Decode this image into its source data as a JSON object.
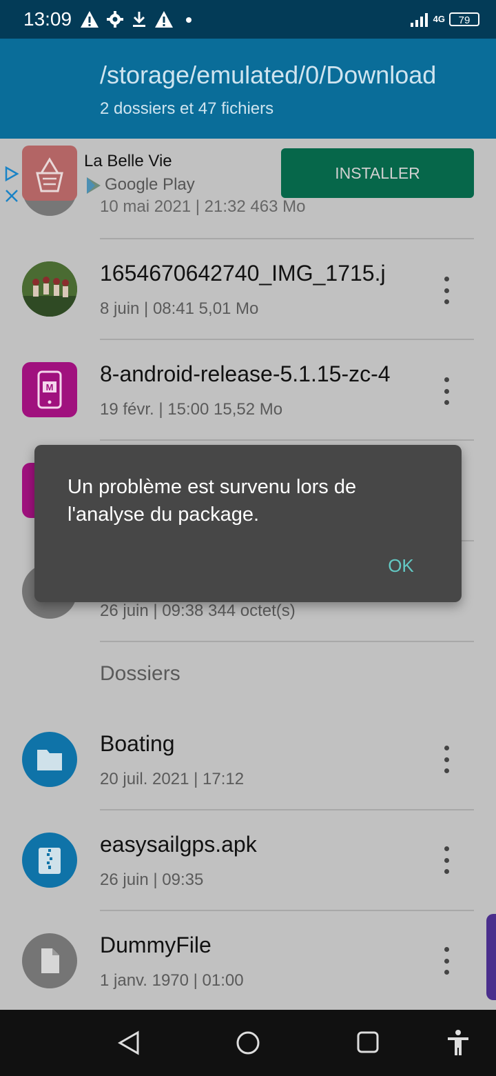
{
  "status_bar": {
    "time": "13:09",
    "network": "4G",
    "battery": "79"
  },
  "header": {
    "path": "/storage/emulated/0/Download",
    "summary": "2 dossiers et 47 fichiers"
  },
  "ad": {
    "app_name": "La Belle Vie",
    "store": "Google Play",
    "install_label": "INSTALLER"
  },
  "partial_item_meta": "10 mai 2021 | 21:32   463 Mo",
  "files": [
    {
      "name": "1654670642740_IMG_1715.j",
      "meta": "8 juin | 08:41    5,01 Mo",
      "icon": "photo-thumbnail"
    },
    {
      "name": "8-android-release-5.1.15-zc-4",
      "meta": "19 févr. | 15:00    15,52 Mo",
      "icon": "app-icon"
    }
  ],
  "hidden_item_meta": "26 juin | 09:38    344 octet(s)",
  "section_label": "Dossiers",
  "folders": [
    {
      "name": "Boating",
      "meta": "20 juil. 2021 | 17:12",
      "icon": "folder-icon"
    },
    {
      "name": "easysailgps.apk",
      "meta": "26 juin | 09:35",
      "icon": "zip-icon"
    },
    {
      "name": "DummyFile",
      "meta": "1 janv. 1970 | 01:00",
      "icon": "file-icon"
    }
  ],
  "dialog": {
    "message": "Un problème est survenu lors de l'analyse du package.",
    "ok_label": "OK"
  },
  "colors": {
    "status_bar": "#033b57",
    "header": "#0a6d99",
    "install_button": "#06674a",
    "dialog": "#474747",
    "dialog_ok": "#63c9c4",
    "folder_icon": "#0f73a8",
    "app_icon": "#a0117e"
  }
}
